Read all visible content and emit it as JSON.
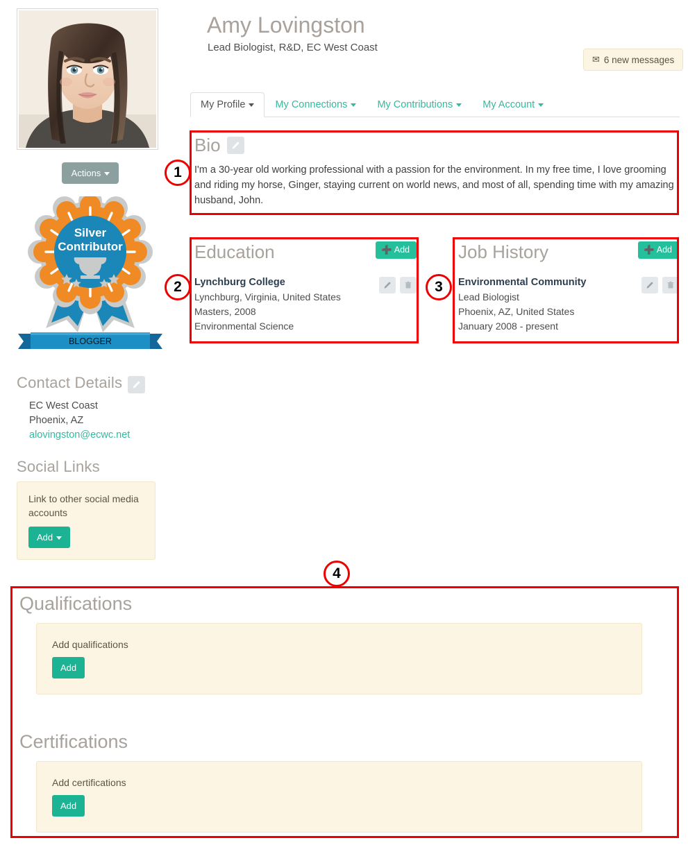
{
  "profile": {
    "name": "Amy Lovingston",
    "subtitle": "Lead Biologist, R&D, EC West Coast",
    "actions_label": "Actions",
    "avatar_alt": "profile-photo"
  },
  "messages": {
    "icon": "envelope-icon",
    "label": "6 new messages"
  },
  "tabs": [
    {
      "label": "My Profile",
      "active": true
    },
    {
      "label": "My Connections",
      "active": false
    },
    {
      "label": "My Contributions",
      "active": false
    },
    {
      "label": "My Account",
      "active": false
    }
  ],
  "badge": {
    "line1": "Silver",
    "line2": "Contributor",
    "ribbon": "BLOGGER",
    "colors": {
      "orange": "#F08A24",
      "blue": "#1B87B8",
      "silver": "#C9CBCA",
      "ribbon": "#1C8FC4"
    }
  },
  "contact": {
    "heading": "Contact Details",
    "edit_icon": "pencil-icon",
    "lines": [
      "EC West Coast",
      "Phoenix, AZ"
    ],
    "email": "alovingston@ecwc.net"
  },
  "social": {
    "heading": "Social Links",
    "prompt": "Link to other social media accounts",
    "add_label": "Add"
  },
  "bio": {
    "heading": "Bio",
    "edit_icon": "pencil-icon",
    "text": "I'm a 30-year old working professional with a passion for the environment. In my free time, I love grooming and riding my horse, Ginger, staying current on world news, and most of all, spending time with my amazing husband, John."
  },
  "education": {
    "heading": "Education",
    "add_label": "Add",
    "entries": [
      {
        "title": "Lynchburg College",
        "line2": "Lynchburg, Virginia, United States",
        "line3": "Masters, 2008",
        "line4": "Environmental Science"
      }
    ]
  },
  "job_history": {
    "heading": "Job History",
    "add_label": "Add",
    "entries": [
      {
        "title": "Environmental Community",
        "line2": "Lead Biologist",
        "line3": "Phoenix, AZ, United States",
        "line4": "January 2008 - present"
      }
    ]
  },
  "qualifications": {
    "heading": "Qualifications",
    "prompt": "Add qualifications",
    "add_label": "Add"
  },
  "certifications": {
    "heading": "Certifications",
    "prompt": "Add certifications",
    "add_label": "Add"
  },
  "annotations": [
    {
      "number": "1"
    },
    {
      "number": "2"
    },
    {
      "number": "3"
    },
    {
      "number": "4"
    }
  ],
  "colors": {
    "accent_green": "#1bb394",
    "add_green": "#24c09b",
    "heading_gray": "#a8a29c",
    "cream": "#fcf5e3",
    "annotation_red": "#ee0000"
  }
}
